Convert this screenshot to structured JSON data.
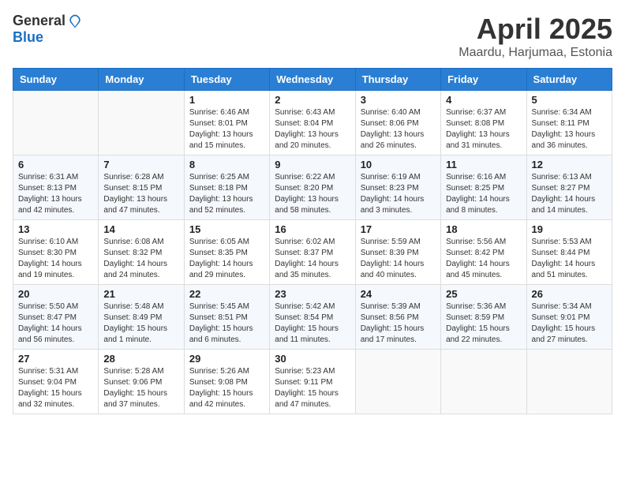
{
  "header": {
    "logo_general": "General",
    "logo_blue": "Blue",
    "month_title": "April 2025",
    "location": "Maardu, Harjumaa, Estonia"
  },
  "calendar": {
    "days_of_week": [
      "Sunday",
      "Monday",
      "Tuesday",
      "Wednesday",
      "Thursday",
      "Friday",
      "Saturday"
    ],
    "weeks": [
      [
        {
          "day": "",
          "info": ""
        },
        {
          "day": "",
          "info": ""
        },
        {
          "day": "1",
          "info": "Sunrise: 6:46 AM\nSunset: 8:01 PM\nDaylight: 13 hours and 15 minutes."
        },
        {
          "day": "2",
          "info": "Sunrise: 6:43 AM\nSunset: 8:04 PM\nDaylight: 13 hours and 20 minutes."
        },
        {
          "day": "3",
          "info": "Sunrise: 6:40 AM\nSunset: 8:06 PM\nDaylight: 13 hours and 26 minutes."
        },
        {
          "day": "4",
          "info": "Sunrise: 6:37 AM\nSunset: 8:08 PM\nDaylight: 13 hours and 31 minutes."
        },
        {
          "day": "5",
          "info": "Sunrise: 6:34 AM\nSunset: 8:11 PM\nDaylight: 13 hours and 36 minutes."
        }
      ],
      [
        {
          "day": "6",
          "info": "Sunrise: 6:31 AM\nSunset: 8:13 PM\nDaylight: 13 hours and 42 minutes."
        },
        {
          "day": "7",
          "info": "Sunrise: 6:28 AM\nSunset: 8:15 PM\nDaylight: 13 hours and 47 minutes."
        },
        {
          "day": "8",
          "info": "Sunrise: 6:25 AM\nSunset: 8:18 PM\nDaylight: 13 hours and 52 minutes."
        },
        {
          "day": "9",
          "info": "Sunrise: 6:22 AM\nSunset: 8:20 PM\nDaylight: 13 hours and 58 minutes."
        },
        {
          "day": "10",
          "info": "Sunrise: 6:19 AM\nSunset: 8:23 PM\nDaylight: 14 hours and 3 minutes."
        },
        {
          "day": "11",
          "info": "Sunrise: 6:16 AM\nSunset: 8:25 PM\nDaylight: 14 hours and 8 minutes."
        },
        {
          "day": "12",
          "info": "Sunrise: 6:13 AM\nSunset: 8:27 PM\nDaylight: 14 hours and 14 minutes."
        }
      ],
      [
        {
          "day": "13",
          "info": "Sunrise: 6:10 AM\nSunset: 8:30 PM\nDaylight: 14 hours and 19 minutes."
        },
        {
          "day": "14",
          "info": "Sunrise: 6:08 AM\nSunset: 8:32 PM\nDaylight: 14 hours and 24 minutes."
        },
        {
          "day": "15",
          "info": "Sunrise: 6:05 AM\nSunset: 8:35 PM\nDaylight: 14 hours and 29 minutes."
        },
        {
          "day": "16",
          "info": "Sunrise: 6:02 AM\nSunset: 8:37 PM\nDaylight: 14 hours and 35 minutes."
        },
        {
          "day": "17",
          "info": "Sunrise: 5:59 AM\nSunset: 8:39 PM\nDaylight: 14 hours and 40 minutes."
        },
        {
          "day": "18",
          "info": "Sunrise: 5:56 AM\nSunset: 8:42 PM\nDaylight: 14 hours and 45 minutes."
        },
        {
          "day": "19",
          "info": "Sunrise: 5:53 AM\nSunset: 8:44 PM\nDaylight: 14 hours and 51 minutes."
        }
      ],
      [
        {
          "day": "20",
          "info": "Sunrise: 5:50 AM\nSunset: 8:47 PM\nDaylight: 14 hours and 56 minutes."
        },
        {
          "day": "21",
          "info": "Sunrise: 5:48 AM\nSunset: 8:49 PM\nDaylight: 15 hours and 1 minute."
        },
        {
          "day": "22",
          "info": "Sunrise: 5:45 AM\nSunset: 8:51 PM\nDaylight: 15 hours and 6 minutes."
        },
        {
          "day": "23",
          "info": "Sunrise: 5:42 AM\nSunset: 8:54 PM\nDaylight: 15 hours and 11 minutes."
        },
        {
          "day": "24",
          "info": "Sunrise: 5:39 AM\nSunset: 8:56 PM\nDaylight: 15 hours and 17 minutes."
        },
        {
          "day": "25",
          "info": "Sunrise: 5:36 AM\nSunset: 8:59 PM\nDaylight: 15 hours and 22 minutes."
        },
        {
          "day": "26",
          "info": "Sunrise: 5:34 AM\nSunset: 9:01 PM\nDaylight: 15 hours and 27 minutes."
        }
      ],
      [
        {
          "day": "27",
          "info": "Sunrise: 5:31 AM\nSunset: 9:04 PM\nDaylight: 15 hours and 32 minutes."
        },
        {
          "day": "28",
          "info": "Sunrise: 5:28 AM\nSunset: 9:06 PM\nDaylight: 15 hours and 37 minutes."
        },
        {
          "day": "29",
          "info": "Sunrise: 5:26 AM\nSunset: 9:08 PM\nDaylight: 15 hours and 42 minutes."
        },
        {
          "day": "30",
          "info": "Sunrise: 5:23 AM\nSunset: 9:11 PM\nDaylight: 15 hours and 47 minutes."
        },
        {
          "day": "",
          "info": ""
        },
        {
          "day": "",
          "info": ""
        },
        {
          "day": "",
          "info": ""
        }
      ]
    ]
  }
}
